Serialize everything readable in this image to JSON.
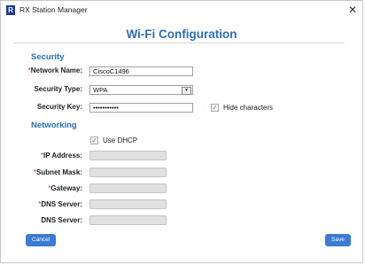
{
  "window": {
    "title": "RX Station Manager",
    "icon_name": "app-logo-icon"
  },
  "heading": "Wi-Fi Configuration",
  "security": {
    "section_title": "Security",
    "network_name": {
      "label": "Network Name:",
      "value": "CiscoC1496",
      "required": true
    },
    "security_type": {
      "label": "Security Type:",
      "value": "WPA"
    },
    "security_key": {
      "label": "Security Key:",
      "value": "•••••••••••"
    },
    "hide_characters": {
      "label": "Hide characters",
      "checked": true
    }
  },
  "networking": {
    "section_title": "Networking",
    "use_dhcp": {
      "label": "Use DHCP",
      "checked": true
    },
    "ip_address": {
      "label": "IP Address:",
      "required": true
    },
    "subnet_mask": {
      "label": "Subnet Mask:",
      "required": true
    },
    "gateway": {
      "label": "Gateway:",
      "required": true
    },
    "dns_server_1": {
      "label": "DNS Server:",
      "required": true
    },
    "dns_server_2": {
      "label": "DNS Server:",
      "required": false
    }
  },
  "buttons": {
    "cancel": "Cancel",
    "save": "Save"
  },
  "colors": {
    "accent": "#2a6ebb",
    "button": "#3a7bd5",
    "required": "#c0392b"
  }
}
